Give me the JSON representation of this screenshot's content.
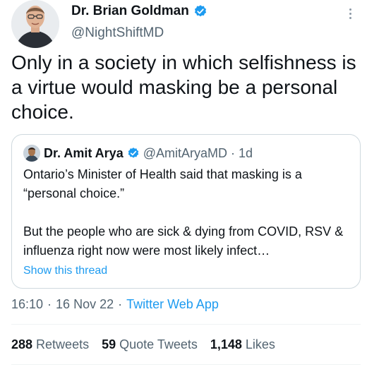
{
  "tweet": {
    "author_name": "Dr. Brian Goldman",
    "author_handle": "@NightShiftMD",
    "text": "Only in a society in which selfishness is a virtue would masking be a personal choice.",
    "time": "16:10",
    "date": "16 Nov 22",
    "source": "Twitter Web App",
    "separator": "·"
  },
  "quoted": {
    "author_name": "Dr. Amit Arya",
    "author_handle": "@AmitAryaMD",
    "separator": "·",
    "time_ago": "1d",
    "text_line1": "Ontario’s Minister of Health said that masking is a “personal choice.”",
    "text_line2": "But the people who are sick & dying from COVID, RSV & influenza right now were most likely infect…",
    "show_thread": "Show this thread"
  },
  "stats": {
    "retweets_count": "288",
    "retweets_label": "Retweets",
    "quotes_count": "59",
    "quotes_label": "Quote Tweets",
    "likes_count": "1,148",
    "likes_label": "Likes"
  },
  "colors": {
    "verified": "#1d9bf0",
    "link": "#1d9bf0",
    "muted": "#536471"
  }
}
